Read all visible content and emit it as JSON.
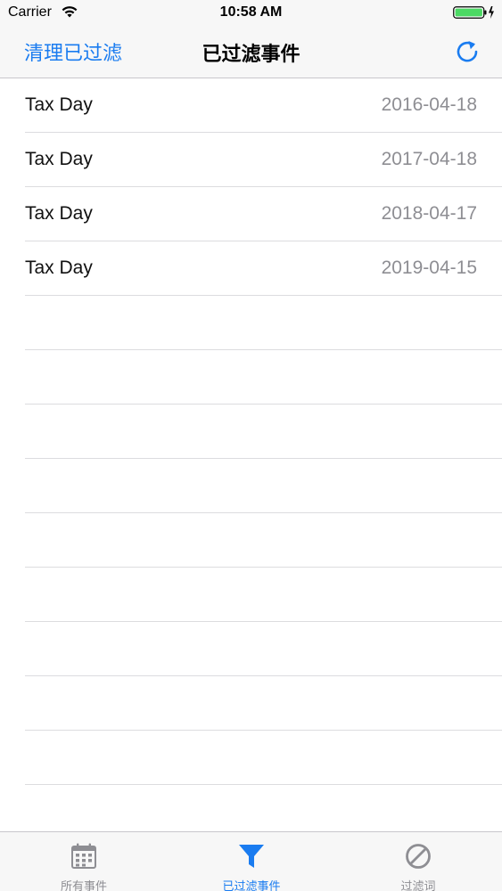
{
  "status_bar": {
    "carrier": "Carrier",
    "time": "10:58 AM",
    "battery_color": "#4cd964"
  },
  "nav": {
    "left_button": "清理已过滤",
    "title": "已过滤事件",
    "accent_color": "#1a7cf0"
  },
  "events": [
    {
      "title": "Tax Day",
      "date": "2016-04-18"
    },
    {
      "title": "Tax Day",
      "date": "2017-04-18"
    },
    {
      "title": "Tax Day",
      "date": "2018-04-17"
    },
    {
      "title": "Tax Day",
      "date": "2019-04-15"
    }
  ],
  "tabs": [
    {
      "label": "所有事件",
      "icon": "calendar-icon",
      "active": false
    },
    {
      "label": "已过滤事件",
      "icon": "filter-icon",
      "active": true
    },
    {
      "label": "过滤词",
      "icon": "prohibited-icon",
      "active": false
    }
  ]
}
